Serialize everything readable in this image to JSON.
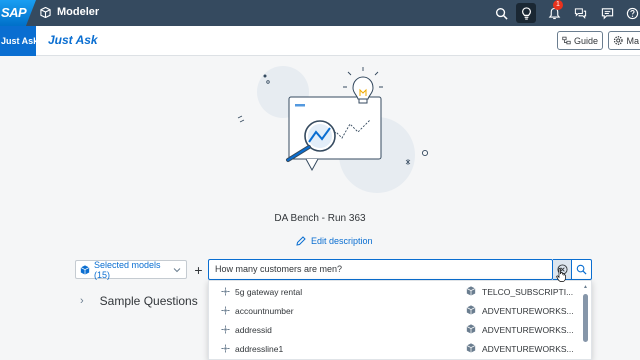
{
  "shell": {
    "logo_text": "SAP",
    "app_name": "Modeler",
    "notification_count": "1",
    "icons": [
      "search-icon",
      "lightbulb-icon",
      "bell-icon",
      "discussion-icon",
      "feedback-icon",
      "help-icon"
    ]
  },
  "header": {
    "tab_label": "Just Ask",
    "title": "Just Ask",
    "guide_label": "Guide",
    "manage_label": "Ma"
  },
  "main": {
    "run_title": "DA Bench - Run 363",
    "edit_description_label": "Edit description",
    "model_select_label": "Selected models (15)",
    "query_value": "How many customers are men?",
    "sample_questions_label": "Sample Questions"
  },
  "suggestions": [
    {
      "name": "5g gateway rental",
      "table": "TELCO_SUBSCRIPTI..."
    },
    {
      "name": "accountnumber",
      "table": "ADVENTUREWORKS..."
    },
    {
      "name": "addressid",
      "table": "ADVENTUREWORKS..."
    },
    {
      "name": "addressline1",
      "table": "ADVENTUREWORKS..."
    }
  ],
  "colors": {
    "shell_bg": "#354a5f",
    "accent": "#0a6ed1",
    "page_bg": "#f5f6f7",
    "badge": "#e9321d"
  }
}
